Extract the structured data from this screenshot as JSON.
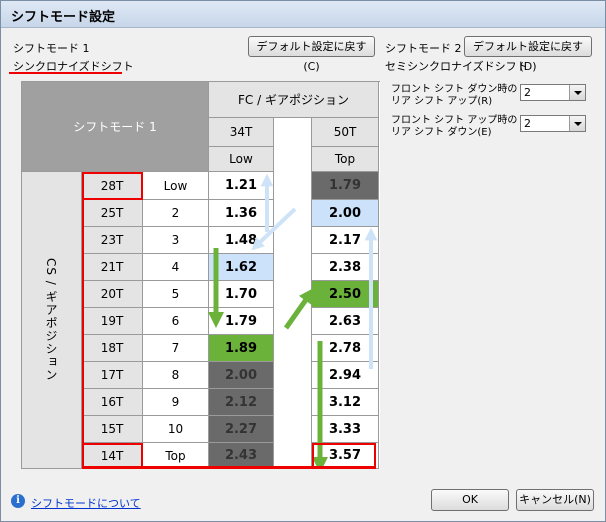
{
  "window": {
    "title": "シフトモード設定"
  },
  "mode1": {
    "label": "シフトモード 1",
    "value": "シンクロナイズドシフト",
    "reset_button": "デフォルト設定に戻す(C)"
  },
  "mode2": {
    "label": "シフトモード 2",
    "reset_button": "デフォルト設定に戻す(D)",
    "value": "セミシンクロナイズドシフト",
    "setting1": {
      "label_line1": "フロント シフト ダウン時の",
      "label_line2": "リア シフト アップ(R)",
      "value": "2"
    },
    "setting2": {
      "label_line1": "フロント シフト アップ時の",
      "label_line2": "リア シフト ダウン(E)",
      "value": "2"
    }
  },
  "table": {
    "corner_label": "シフトモード 1",
    "fc_header": "FC / ギアポジション",
    "cs_header": "CS / ギアポジション",
    "fc_cols": [
      {
        "teeth": "34T",
        "pos": "Low"
      },
      {
        "teeth": "50T",
        "pos": "Top"
      }
    ],
    "rows": [
      {
        "cs": "28T",
        "pos": "Low",
        "v34": "1.21",
        "v50": "1.79"
      },
      {
        "cs": "25T",
        "pos": "2",
        "v34": "1.36",
        "v50": "2.00"
      },
      {
        "cs": "23T",
        "pos": "3",
        "v34": "1.48",
        "v50": "2.17"
      },
      {
        "cs": "21T",
        "pos": "4",
        "v34": "1.62",
        "v50": "2.38"
      },
      {
        "cs": "20T",
        "pos": "5",
        "v34": "1.70",
        "v50": "2.50"
      },
      {
        "cs": "19T",
        "pos": "6",
        "v34": "1.79",
        "v50": "2.63"
      },
      {
        "cs": "18T",
        "pos": "7",
        "v34": "1.89",
        "v50": "2.78"
      },
      {
        "cs": "17T",
        "pos": "8",
        "v34": "2.00",
        "v50": "2.94"
      },
      {
        "cs": "16T",
        "pos": "9",
        "v34": "2.12",
        "v50": "3.12"
      },
      {
        "cs": "15T",
        "pos": "10",
        "v34": "2.27",
        "v50": "3.33"
      },
      {
        "cs": "14T",
        "pos": "Top",
        "v34": "2.43",
        "v50": "3.57"
      }
    ]
  },
  "footer": {
    "help_link": "シフトモードについて",
    "ok_button": "OK",
    "cancel_button": "キャンセル(N)"
  },
  "colors": {
    "highlight_green": "#6bb23a",
    "highlight_blue": "#cce2fb",
    "inactive_gray": "#6a6a6a",
    "red_outline": "#ee0000"
  }
}
